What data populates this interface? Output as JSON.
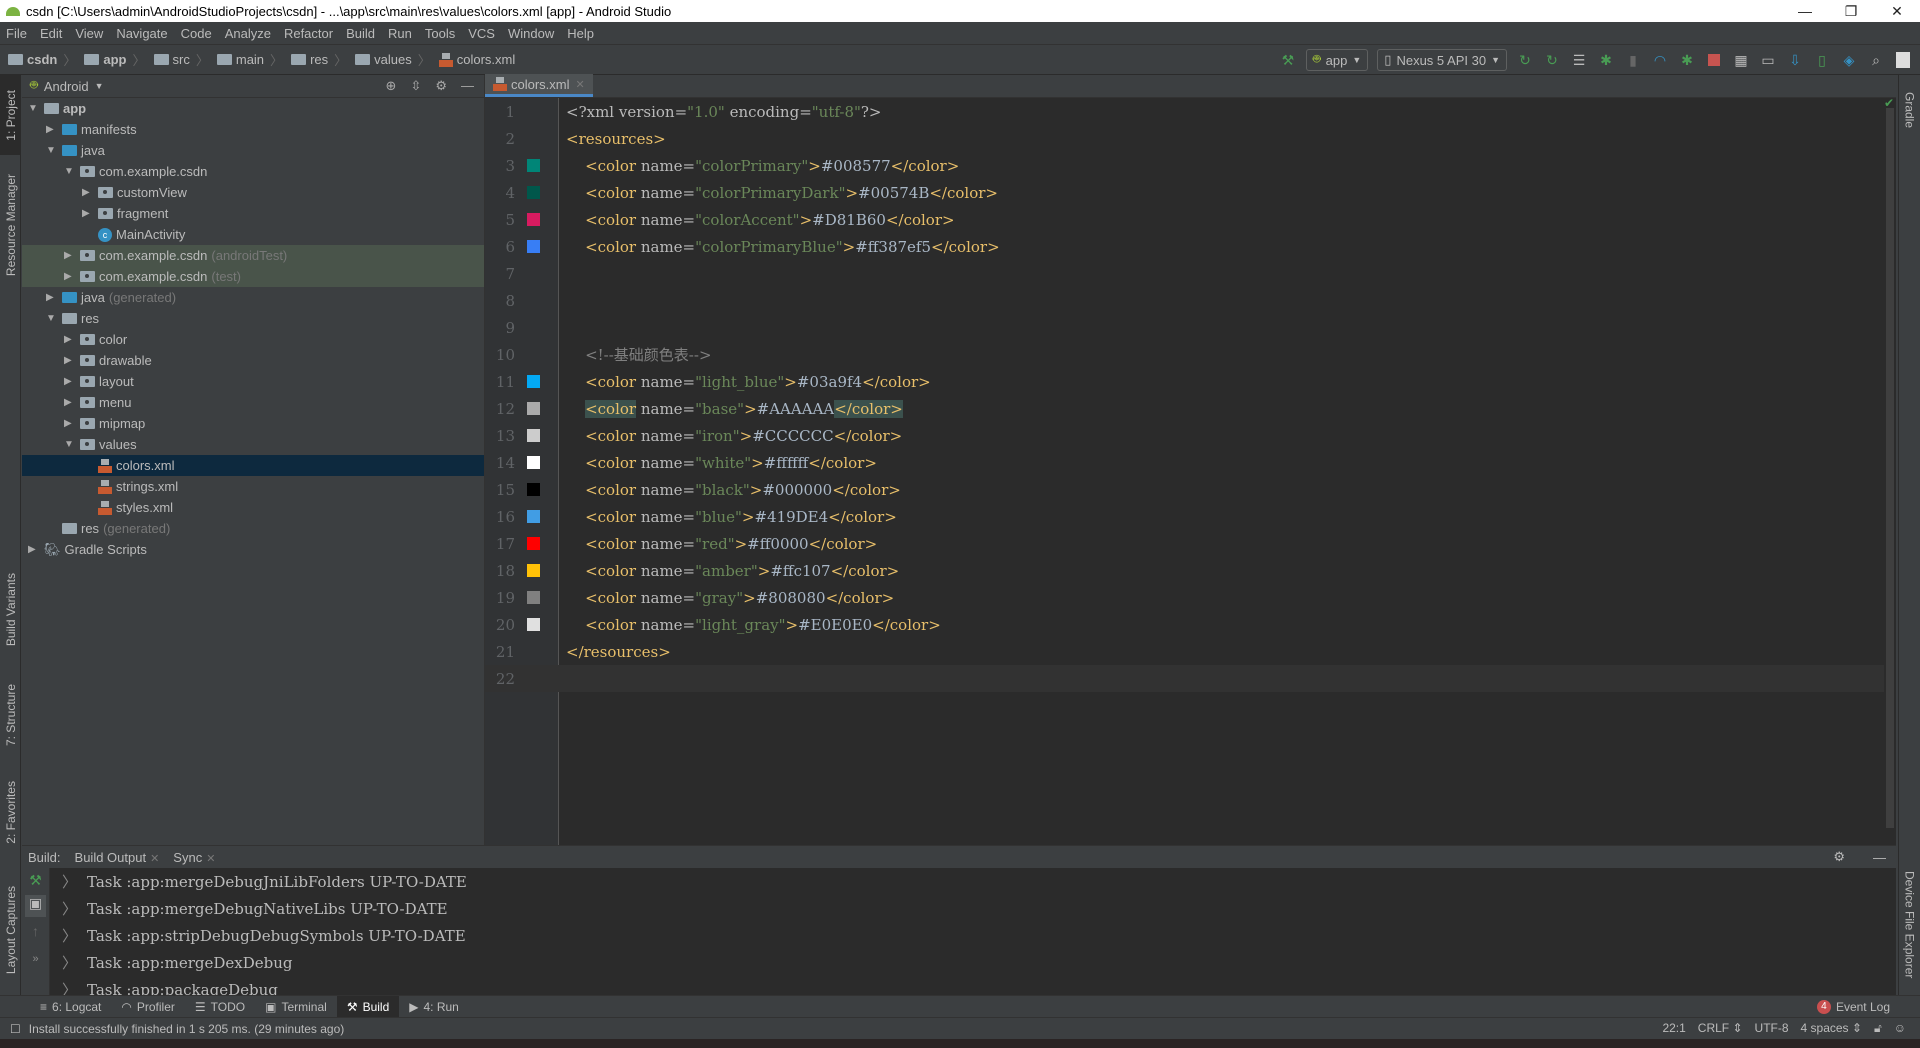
{
  "window": {
    "title": "csdn [C:\\Users\\admin\\AndroidStudioProjects\\csdn] - ...\\app\\src\\main\\res\\values\\colors.xml [app] - Android Studio",
    "minimize": "—",
    "restore": "❐",
    "close": "✕"
  },
  "menu": [
    "File",
    "Edit",
    "View",
    "Navigate",
    "Code",
    "Analyze",
    "Refactor",
    "Build",
    "Run",
    "Tools",
    "VCS",
    "Window",
    "Help"
  ],
  "breadcrumb": [
    "csdn",
    "app",
    "src",
    "main",
    "res",
    "values",
    "colors.xml"
  ],
  "toolbar": {
    "run_config": "app",
    "device": "Nexus 5 API 30",
    "icons": [
      "hammer-icon",
      "apply-changes-icon",
      "apply-code-changes-icon",
      "sync-icon",
      "debug-icon",
      "attach-icon",
      "profiler-icon",
      "attach-debugger-icon",
      "stop-icon",
      "project-structure-icon",
      "avd-manager-icon",
      "sdk-manager-icon",
      "device-manager-icon",
      "resource-icon",
      "search-icon",
      "user-icon"
    ]
  },
  "left_strip": {
    "project": "1: Project",
    "resource_manager": "Resource Manager",
    "build_variants": "Build Variants",
    "structure": "7: Structure",
    "favorites": "2: Favorites",
    "layout_captures": "Layout Captures"
  },
  "right_strip": {
    "gradle": "Gradle",
    "device_file_explorer": "Device File Explorer"
  },
  "project": {
    "view": "Android",
    "tree": [
      {
        "label": "app",
        "indent": 0,
        "arrow": "▼",
        "icon": "module",
        "bold": true
      },
      {
        "label": "manifests",
        "indent": 1,
        "arrow": "▶",
        "icon": "folder-blue"
      },
      {
        "label": "java",
        "indent": 1,
        "arrow": "▼",
        "icon": "folder-blue"
      },
      {
        "label": "com.example.csdn",
        "indent": 2,
        "arrow": "▼",
        "icon": "package"
      },
      {
        "label": "customView",
        "indent": 3,
        "arrow": "▶",
        "icon": "package"
      },
      {
        "label": "fragment",
        "indent": 3,
        "arrow": "▶",
        "icon": "package"
      },
      {
        "label": "MainActivity",
        "indent": 3,
        "arrow": "",
        "icon": "class"
      },
      {
        "label": "com.example.csdn",
        "suffix": "(androidTest)",
        "indent": 2,
        "arrow": "▶",
        "icon": "package",
        "test": true
      },
      {
        "label": "com.example.csdn",
        "suffix": "(test)",
        "indent": 2,
        "arrow": "▶",
        "icon": "package",
        "test": true
      },
      {
        "label": "java",
        "suffix": "(generated)",
        "indent": 1,
        "arrow": "▶",
        "icon": "folder-blue"
      },
      {
        "label": "res",
        "indent": 1,
        "arrow": "▼",
        "icon": "folder"
      },
      {
        "label": "color",
        "indent": 2,
        "arrow": "▶",
        "icon": "package"
      },
      {
        "label": "drawable",
        "indent": 2,
        "arrow": "▶",
        "icon": "package"
      },
      {
        "label": "layout",
        "indent": 2,
        "arrow": "▶",
        "icon": "package"
      },
      {
        "label": "menu",
        "indent": 2,
        "arrow": "▶",
        "icon": "package"
      },
      {
        "label": "mipmap",
        "indent": 2,
        "arrow": "▶",
        "icon": "package"
      },
      {
        "label": "values",
        "indent": 2,
        "arrow": "▼",
        "icon": "package"
      },
      {
        "label": "colors.xml",
        "indent": 3,
        "arrow": "",
        "icon": "xml",
        "selected": true
      },
      {
        "label": "strings.xml",
        "indent": 3,
        "arrow": "",
        "icon": "xml"
      },
      {
        "label": "styles.xml",
        "indent": 3,
        "arrow": "",
        "icon": "xml"
      },
      {
        "label": "res",
        "suffix": "(generated)",
        "indent": 1,
        "arrow": "",
        "icon": "folder"
      },
      {
        "label": "Gradle Scripts",
        "indent": 0,
        "arrow": "▶",
        "icon": "gradle"
      }
    ]
  },
  "editor": {
    "tab": "colors.xml",
    "lines": [
      {
        "n": "1",
        "kind": "decl",
        "text": "<?xml version=\"1.0\" encoding=\"utf-8\"?>"
      },
      {
        "n": "2",
        "kind": "open",
        "text": "<resources>"
      },
      {
        "n": "3",
        "kind": "color",
        "name": "colorPrimary",
        "value": "#008577",
        "swatch": "#008577"
      },
      {
        "n": "4",
        "kind": "color",
        "name": "colorPrimaryDark",
        "value": "#00574B",
        "swatch": "#00574B"
      },
      {
        "n": "5",
        "kind": "color",
        "name": "colorAccent",
        "value": "#D81B60",
        "swatch": "#D81B60"
      },
      {
        "n": "6",
        "kind": "color",
        "name": "colorPrimaryBlue",
        "value": "#ff387ef5",
        "swatch": "#387ef5"
      },
      {
        "n": "7",
        "kind": "blank"
      },
      {
        "n": "8",
        "kind": "blank"
      },
      {
        "n": "9",
        "kind": "blank"
      },
      {
        "n": "10",
        "kind": "comment",
        "text": "<!--基础颜色表-->"
      },
      {
        "n": "11",
        "kind": "color",
        "name": "light_blue",
        "value": "#03a9f4",
        "swatch": "#03a9f4"
      },
      {
        "n": "12",
        "kind": "color",
        "name": "base",
        "value": "#AAAAAA",
        "swatch": "#AAAAAA",
        "highlight": true
      },
      {
        "n": "13",
        "kind": "color",
        "name": "iron",
        "value": "#CCCCCC",
        "swatch": "#CCCCCC"
      },
      {
        "n": "14",
        "kind": "color",
        "name": "white",
        "value": "#ffffff",
        "swatch": "#ffffff"
      },
      {
        "n": "15",
        "kind": "color",
        "name": "black",
        "value": "#000000",
        "swatch": "#000000"
      },
      {
        "n": "16",
        "kind": "color",
        "name": "blue",
        "value": "#419DE4",
        "swatch": "#419DE4"
      },
      {
        "n": "17",
        "kind": "color",
        "name": "red",
        "value": "#ff0000",
        "swatch": "#ff0000"
      },
      {
        "n": "18",
        "kind": "color",
        "name": "amber",
        "value": "#ffc107",
        "swatch": "#ffc107"
      },
      {
        "n": "19",
        "kind": "color",
        "name": "gray",
        "value": "#808080",
        "swatch": "#808080"
      },
      {
        "n": "20",
        "kind": "color",
        "name": "light_gray",
        "value": "#E0E0E0",
        "swatch": "#E0E0E0"
      },
      {
        "n": "21",
        "kind": "close",
        "text": "</resources>"
      },
      {
        "n": "22",
        "kind": "blank",
        "current": true
      }
    ]
  },
  "build": {
    "label": "Build:",
    "tabs": [
      "Build Output",
      "Sync"
    ],
    "output": [
      "Task :app:mergeDebugJniLibFolders UP-TO-DATE",
      "Task :app:mergeDebugNativeLibs UP-TO-DATE",
      "Task :app:stripDebugDebugSymbols UP-TO-DATE",
      "Task :app:mergeDexDebug",
      "Task :app:packageDebug"
    ]
  },
  "bottom_tabs": [
    {
      "label": "6: Logcat",
      "icon": "logcat-icon",
      "glyph": "≡"
    },
    {
      "label": "Profiler",
      "icon": "profiler-icon",
      "glyph": "◠"
    },
    {
      "label": "TODO",
      "icon": "todo-icon",
      "glyph": "☰"
    },
    {
      "label": "Terminal",
      "icon": "terminal-icon",
      "glyph": "▣"
    },
    {
      "label": "Build",
      "icon": "hammer-icon",
      "glyph": "⚒",
      "active": true
    },
    {
      "label": "4: Run",
      "icon": "run-icon",
      "glyph": "▶"
    }
  ],
  "event_log": {
    "count": "4",
    "label": "Event Log"
  },
  "status": {
    "message": "Install successfully finished in 1 s 205 ms. (29 minutes ago)",
    "position": "22:1",
    "line_sep": "CRLF ⇕",
    "encoding": "UTF-8",
    "indent": "4 spaces ⇕"
  }
}
